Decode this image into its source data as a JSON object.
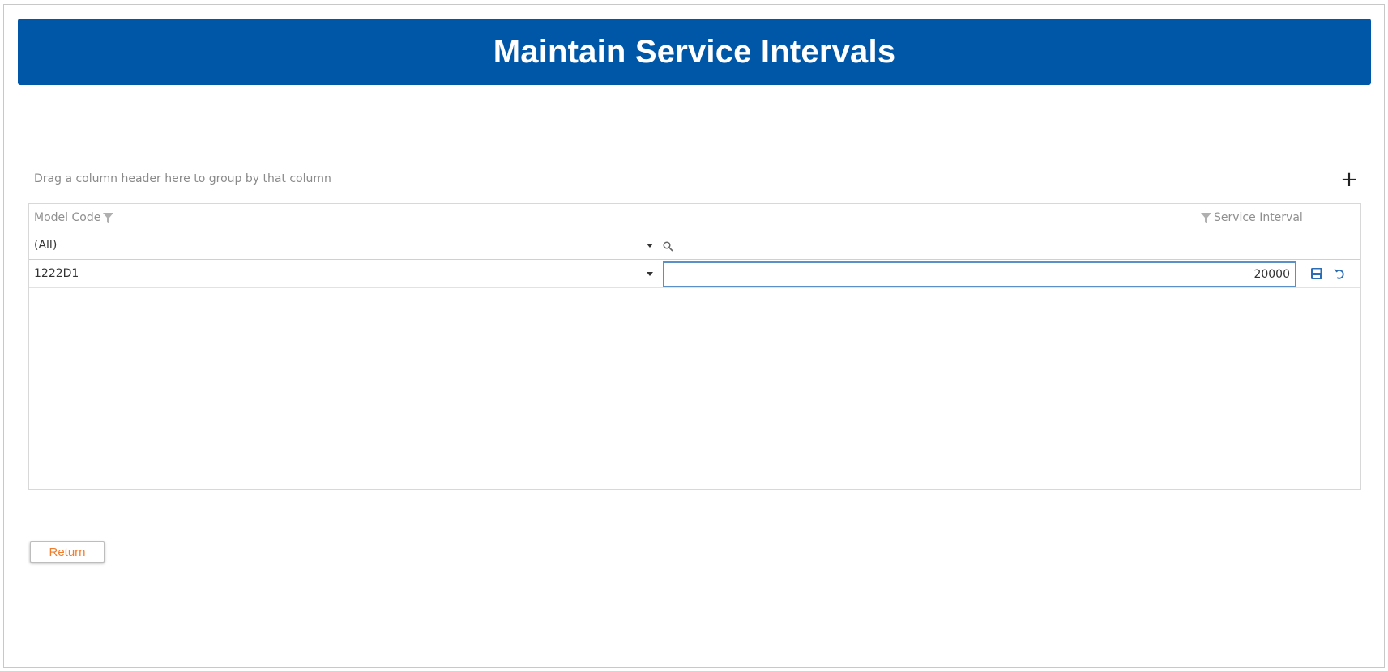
{
  "header": {
    "title": "Maintain Service Intervals"
  },
  "grid": {
    "group_panel_text": "Drag a column header here to group by that column",
    "columns": [
      {
        "label": "Model Code"
      },
      {
        "label": "Service Interval"
      }
    ],
    "filter_row": {
      "model_code_value": "(All)"
    },
    "rows": [
      {
        "model_code": "1222D1",
        "service_interval": "20000"
      }
    ],
    "add_icon": "plus-icon",
    "row_actions": [
      "save-icon",
      "undo-icon"
    ],
    "accent_color": "#0057a8",
    "edit_border_color": "#5b8fc7"
  },
  "footer": {
    "return_label": "Return",
    "return_color": "#f07d2e"
  }
}
